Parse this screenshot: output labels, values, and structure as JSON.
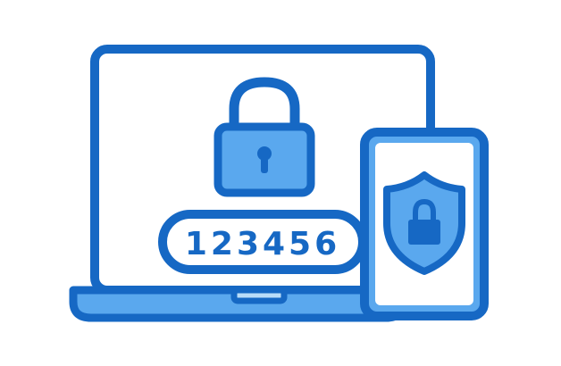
{
  "code": {
    "value": "123456"
  },
  "icons": {
    "laptop": "laptop-icon",
    "padlock": "padlock-icon",
    "keyhole": "keyhole-icon",
    "phone": "smartphone-icon",
    "shield": "shield-icon",
    "shield_lock": "lock-icon"
  },
  "colors": {
    "outline": "#1668c4",
    "fill_light": "#5aa8ee",
    "fill_lighter": "#b9dcf8",
    "background": "#ffffff"
  }
}
